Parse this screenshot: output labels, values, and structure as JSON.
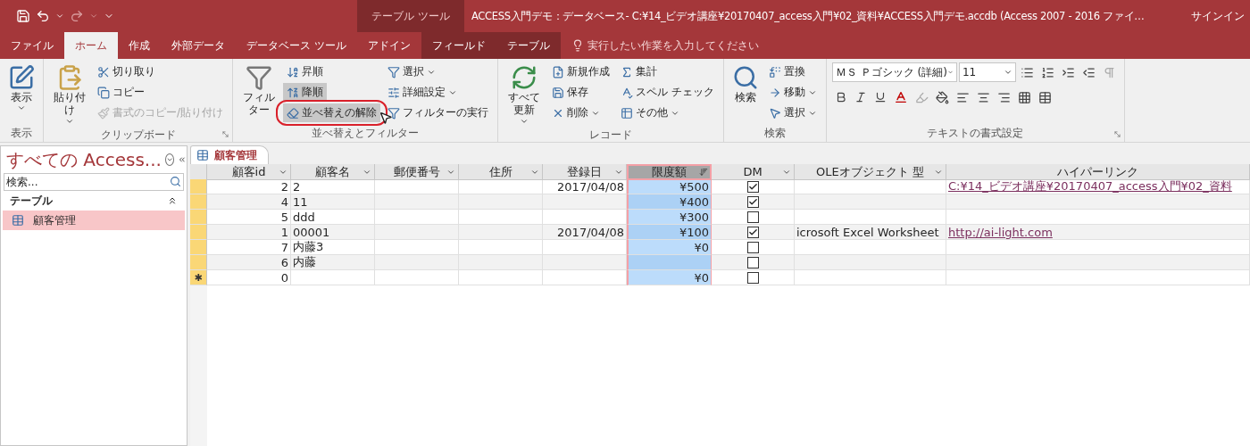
{
  "title_bar": {
    "context_label": "テーブル ツール",
    "title": "ACCESS入門デモ：データベース- C:¥14_ビデオ講座¥20170407_access入門¥02_資料¥ACCESS入門デモ.accdb (Access 2007 - 2016 ファイ…",
    "sign_in": "サインイン"
  },
  "tabs": [
    {
      "label": "ファイル",
      "selected": false,
      "contextual": false
    },
    {
      "label": "ホーム",
      "selected": true,
      "contextual": false
    },
    {
      "label": "作成",
      "selected": false,
      "contextual": false
    },
    {
      "label": "外部データ",
      "selected": false,
      "contextual": false
    },
    {
      "label": "データベース ツール",
      "selected": false,
      "contextual": false
    },
    {
      "label": "アドイン",
      "selected": false,
      "contextual": false
    },
    {
      "label": "フィールド",
      "selected": false,
      "contextual": true
    },
    {
      "label": "テーブル",
      "selected": false,
      "contextual": true
    }
  ],
  "tell_me": {
    "placeholder": "実行したい作業を入力してください"
  },
  "ribbon": {
    "groups": [
      {
        "label": "表示",
        "launcher": false,
        "large": [
          {
            "label": "表示",
            "dropdown": true
          }
        ]
      },
      {
        "label": "クリップボード",
        "launcher": true,
        "large": [
          {
            "label": "貼り付け",
            "dropdown": true
          }
        ],
        "columns": [
          [
            {
              "label": "切り取り",
              "highlighted": false,
              "circled": false,
              "disabled": false,
              "dropdown": false
            },
            {
              "label": "コピー",
              "highlighted": false,
              "circled": false,
              "disabled": false,
              "dropdown": false
            },
            {
              "label": "書式のコピー/貼り付け",
              "highlighted": false,
              "circled": false,
              "disabled": true,
              "dropdown": false
            }
          ]
        ]
      },
      {
        "label": "並べ替えとフィルター",
        "launcher": false,
        "large": [
          {
            "label": "フィルター",
            "dropdown": false
          }
        ],
        "columns": [
          [
            {
              "label": "昇順",
              "highlighted": false,
              "circled": false,
              "disabled": false,
              "dropdown": false
            },
            {
              "label": "降順",
              "highlighted": true,
              "circled": false,
              "disabled": false,
              "dropdown": false
            },
            {
              "label": "並べ替えの解除",
              "highlighted": true,
              "circled": true,
              "disabled": false,
              "dropdown": false
            }
          ],
          [
            {
              "label": "選択",
              "highlighted": false,
              "circled": false,
              "disabled": false,
              "dropdown": true
            },
            {
              "label": "詳細設定",
              "highlighted": false,
              "circled": false,
              "disabled": false,
              "dropdown": true
            },
            {
              "label": "フィルターの実行",
              "highlighted": false,
              "circled": false,
              "disabled": false,
              "dropdown": false
            }
          ]
        ]
      },
      {
        "label": "レコード",
        "launcher": false,
        "large": [
          {
            "label": "すべて更新",
            "dropdown": true
          }
        ],
        "columns": [
          [
            {
              "label": "新規作成",
              "highlighted": false,
              "circled": false,
              "disabled": false,
              "dropdown": false
            },
            {
              "label": "保存",
              "highlighted": false,
              "circled": false,
              "disabled": false,
              "dropdown": false
            },
            {
              "label": "削除",
              "highlighted": false,
              "circled": false,
              "disabled": false,
              "dropdown": true
            }
          ],
          [
            {
              "label": "集計",
              "highlighted": false,
              "circled": false,
              "disabled": false,
              "dropdown": false
            },
            {
              "label": "スペル チェック",
              "highlighted": false,
              "circled": false,
              "disabled": false,
              "dropdown": false
            },
            {
              "label": "その他",
              "highlighted": false,
              "circled": false,
              "disabled": false,
              "dropdown": true
            }
          ]
        ]
      },
      {
        "label": "検索",
        "launcher": false,
        "large": [
          {
            "label": "検索",
            "dropdown": false
          }
        ],
        "columns": [
          [
            {
              "label": "置換",
              "highlighted": false,
              "circled": false,
              "disabled": false,
              "dropdown": false
            },
            {
              "label": "移動",
              "highlighted": false,
              "circled": false,
              "disabled": false,
              "dropdown": true
            },
            {
              "label": "選択",
              "highlighted": false,
              "circled": false,
              "disabled": false,
              "dropdown": true
            }
          ]
        ]
      },
      {
        "label": "テキストの書式設定",
        "launcher": true,
        "font": "ＭＳ Ｐゴシック (詳細)",
        "size": "11"
      }
    ]
  },
  "nav": {
    "title": "すべての Access...",
    "search": {
      "placeholder": "検索..."
    },
    "group": "テーブル",
    "items": [
      {
        "label": "顧客管理",
        "selected": true
      }
    ]
  },
  "document_tab": "顧客管理",
  "table": {
    "columns": [
      {
        "label": "顧客id",
        "filter": true,
        "selected": false
      },
      {
        "label": "顧客名",
        "filter": true,
        "selected": false
      },
      {
        "label": "郵便番号",
        "filter": true,
        "selected": false
      },
      {
        "label": "住所",
        "filter": true,
        "selected": false
      },
      {
        "label": "登録日",
        "filter": true,
        "selected": false
      },
      {
        "label": "限度額",
        "filter": true,
        "selected": true
      },
      {
        "label": "DM",
        "filter": true,
        "selected": false
      },
      {
        "label": "OLEオブジェクト 型",
        "filter": true,
        "selected": false
      },
      {
        "label": "ハイパーリンク",
        "filter": false,
        "selected": false
      }
    ],
    "rows": [
      {
        "id": "2",
        "name": "2",
        "date": "2017/04/08",
        "limit": "¥500",
        "dm": true,
        "link": "C:¥14_ビデオ講座¥20170407_access入門¥02_資料"
      },
      {
        "id": "4",
        "name": "11",
        "limit": "¥400",
        "dm": true
      },
      {
        "id": "5",
        "name": "ddd",
        "limit": "¥300",
        "dm": false
      },
      {
        "id": "1",
        "name": "00001",
        "date": "2017/04/08",
        "limit": "¥100",
        "dm": true,
        "ole": "icrosoft Excel Worksheet",
        "link": "http://ai-light.com"
      },
      {
        "id": "7",
        "name": "内藤3",
        "limit": "¥0",
        "dm": false
      },
      {
        "id": "6",
        "name": "内藤",
        "dm": false
      },
      {
        "marker": "✱",
        "id": "0",
        "limit": "¥0",
        "dm": false
      }
    ]
  }
}
